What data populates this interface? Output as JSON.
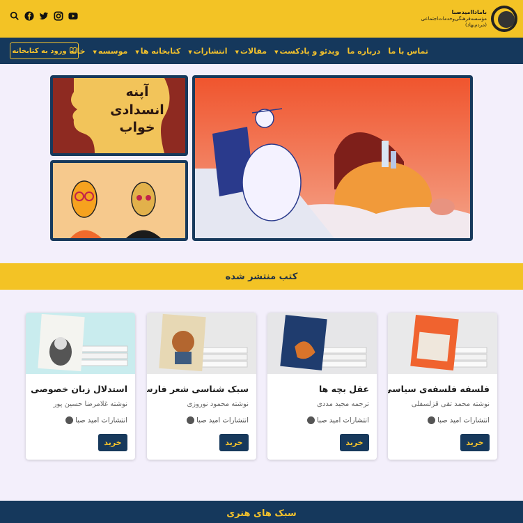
{
  "brand": {
    "line1": "باماداامیدصبا",
    "line2": "مؤسسه‌فرهنگی‌وخدمات‌اجتماعی",
    "line3": "(مردم‌نهاد)"
  },
  "socials": [
    {
      "icon": "youtube-icon"
    },
    {
      "icon": "instagram-icon"
    },
    {
      "icon": "twitter-icon"
    },
    {
      "icon": "facebook-icon"
    },
    {
      "icon": "search-icon"
    }
  ],
  "nav": {
    "items": [
      {
        "label": "خانه",
        "dropdown": false
      },
      {
        "label": "موسسه",
        "dropdown": true
      },
      {
        "label": "کتابخانه ها",
        "dropdown": true
      },
      {
        "label": "انتشارات",
        "dropdown": true
      },
      {
        "label": "مقالات",
        "dropdown": true
      },
      {
        "label": "ویدئو و پادکست",
        "dropdown": true
      },
      {
        "label": "درباره ما",
        "dropdown": false
      },
      {
        "label": "تماس با ما",
        "dropdown": false
      }
    ],
    "login_label": "ورود به کتابخانه"
  },
  "hero": {
    "side_poster_text": "آپنه انسدادی خواب"
  },
  "section_books": {
    "title": "کتب منتشر شده",
    "books": [
      {
        "title": "فلسفه فلسفه‌ی سیاسی",
        "author": "نوشته محمد تقی قزلسفلی",
        "publisher": "انتشارات امید صبا",
        "buy_label": "خرید"
      },
      {
        "title": "عقل بچه ها",
        "author": "ترجمه مجید مددی",
        "publisher": "انتشارات امید صبا",
        "buy_label": "خرید"
      },
      {
        "title": "سبک شناسی شعر فارسی",
        "author": "نوشته محمود نوروزی",
        "publisher": "انتشارات امید صبا",
        "buy_label": "خرید"
      },
      {
        "title": "استدلال زبان خصوصی",
        "author": "نوشته غلامرضا حسین پور",
        "publisher": "انتشارات امید صبا",
        "buy_label": "خرید"
      }
    ]
  },
  "section_art": {
    "title": "سبک های هنری"
  },
  "colors": {
    "accent": "#f3c325",
    "navy": "#15385c"
  }
}
